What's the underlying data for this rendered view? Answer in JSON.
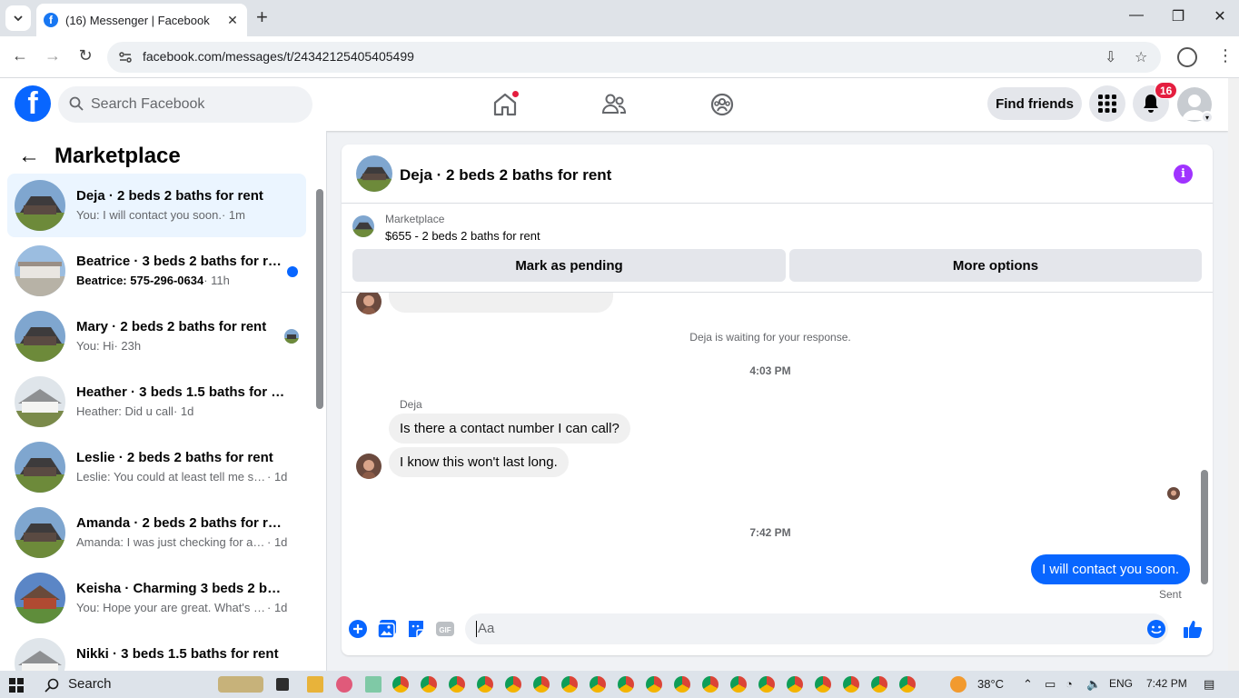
{
  "browser": {
    "tab_title": "(16) Messenger | Facebook",
    "url": "facebook.com/messages/t/24342125405405499"
  },
  "fb_header": {
    "search_placeholder": "Search Facebook",
    "find_friends_label": "Find friends",
    "notification_count": "16"
  },
  "sidebar": {
    "title": "Marketplace",
    "conversations": [
      {
        "title": "Deja · 2 beds 2 baths for rent",
        "preview": "You: I will contact you soon.",
        "time": "· 1m",
        "active": true
      },
      {
        "title": "Beatrice · 3 beds 2 baths for rent",
        "preview": "Beatrice: 575-296-0634",
        "time": "· 11h",
        "unread": true
      },
      {
        "title": "Mary · 2 beds 2 baths for rent",
        "preview": "You: Hi",
        "time": "· 23h"
      },
      {
        "title": "Heather · 3 beds 1.5 baths for rent",
        "preview": "Heather: Did u call",
        "time": "· 1d"
      },
      {
        "title": "Leslie · 2 beds 2 baths for rent",
        "preview": "Leslie: You could at least tell me so...",
        "time": "· 1d"
      },
      {
        "title": "Amanda · 2 beds 2 baths for rent",
        "preview": "Amanda: I was just checking for a f...",
        "time": "· 1d"
      },
      {
        "title": "Keisha · Charming 3 beds 2 bath...",
        "preview": "You: Hope your are great. What's y...",
        "time": "· 1d"
      },
      {
        "title": "Nikki · 3 beds 1.5 baths for rent",
        "preview": "",
        "time": ""
      }
    ]
  },
  "chat": {
    "title": "Deja · 2 beds 2 baths for rent",
    "marketplace_label": "Marketplace",
    "listing": "$655 - 2 beds 2 baths for rent",
    "mark_pending_label": "Mark as pending",
    "more_options_label": "More options",
    "waiting_text": "Deja is waiting for your response.",
    "time_1": "4:03 PM",
    "sender_name": "Deja",
    "msg_1": "Is there a contact number I can call?",
    "msg_2": "I know this won't last long.",
    "time_2": "7:42 PM",
    "my_msg": "I will contact you soon.",
    "sent_status": "Sent",
    "input_placeholder": "Aa"
  },
  "taskbar": {
    "search_label": "Search",
    "weather": "38°C",
    "language": "ENG",
    "clock": "7:42 PM"
  },
  "colors": {
    "fb_blue": "#0866ff",
    "badge_red": "#e41e3f",
    "info_purple": "#a033ff"
  }
}
